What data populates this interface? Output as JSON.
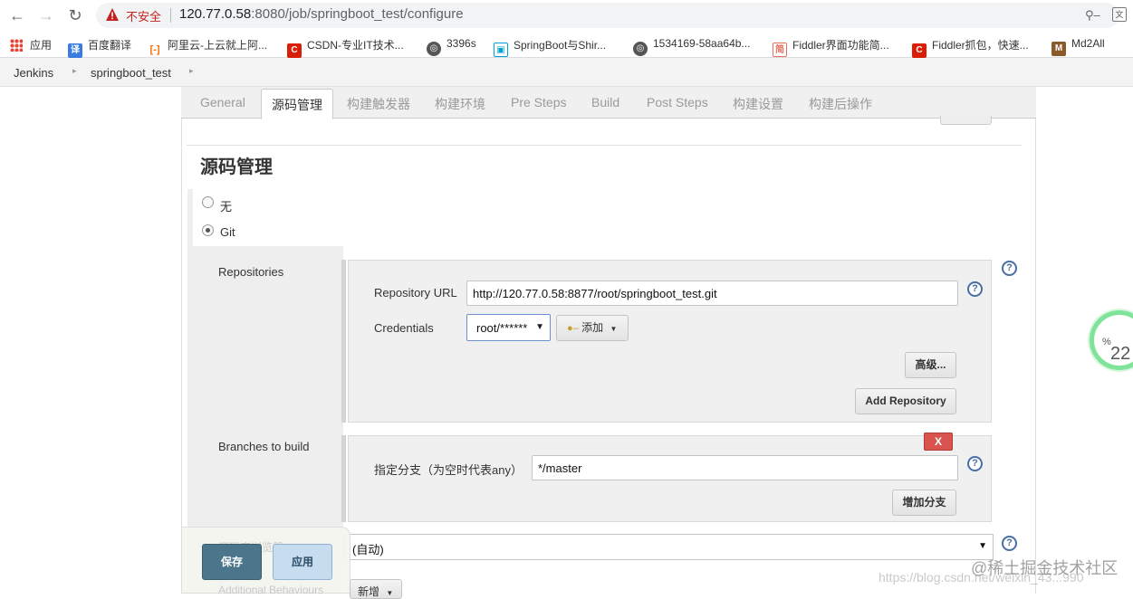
{
  "browser": {
    "insecure_label": "不安全",
    "url_host": "120.77.0.58",
    "url_rest": ":8080/job/springboot_test/configure"
  },
  "bookmarks": [
    {
      "label": "应用",
      "icon": "apps-grid-icon"
    },
    {
      "label": "百度翻译",
      "icon": "baidu-translate-icon",
      "color": "#3a7be0",
      "glyph": "译"
    },
    {
      "label": "阿里云-上云就上阿...",
      "icon": "aliyun-icon",
      "color": "#ff6a00",
      "glyph": "[-]"
    },
    {
      "label": "CSDN-专业IT技术...",
      "icon": "csdn-icon",
      "color": "#d81e06",
      "glyph": "C"
    },
    {
      "label": "3396s",
      "icon": "globe-icon",
      "color": "#555",
      "glyph": "◎"
    },
    {
      "label": "SpringBoot与Shir...",
      "icon": "bilibili-icon",
      "color": "#00a1d6",
      "glyph": "▣"
    },
    {
      "label": "1534169-58aa64b...",
      "icon": "globe-icon",
      "color": "#555",
      "glyph": "◎"
    },
    {
      "label": "Fiddler界面功能简...",
      "icon": "jianshu-icon",
      "color": "#ea6f5a",
      "glyph": "简"
    },
    {
      "label": "Fiddler抓包，快速...",
      "icon": "csdn-icon",
      "color": "#d81e06",
      "glyph": "C"
    },
    {
      "label": "Md2All",
      "icon": "md2all-icon",
      "color": "#8b5a2b",
      "glyph": "M"
    }
  ],
  "breadcrumb": [
    "Jenkins",
    "springboot_test"
  ],
  "tabs": [
    {
      "label": "General",
      "active": false
    },
    {
      "label": "源码管理",
      "active": true
    },
    {
      "label": "构建触发器",
      "active": false
    },
    {
      "label": "构建环境",
      "active": false
    },
    {
      "label": "Pre Steps",
      "active": false
    },
    {
      "label": "Build",
      "active": false
    },
    {
      "label": "Post Steps",
      "active": false
    },
    {
      "label": "构建设置",
      "active": false
    },
    {
      "label": "构建后操作",
      "active": false
    }
  ],
  "scm": {
    "title": "源码管理",
    "option_none": "无",
    "option_git": "Git",
    "selected": "Git",
    "repositories_label": "Repositories",
    "repo_url_label": "Repository URL",
    "repo_url_value": "http://120.77.0.58:8877/root/springboot_test.git",
    "credentials_label": "Credentials",
    "credentials_value": "root/******",
    "add_button": "添加",
    "advanced_button": "高级...",
    "add_repository_button": "Add Repository",
    "branches_label": "Branches to build",
    "branch_spec_label": "指定分支（为空时代表any）",
    "branch_spec_value": "*/master",
    "delete_button": "X",
    "add_branch_button": "增加分支",
    "browser_label": "源码库浏览器",
    "browser_value": "(自动)",
    "behaviours_label": "Additional Behaviours",
    "new_button": "新增"
  },
  "footer": {
    "save": "保存",
    "apply": "应用"
  },
  "overlay": {
    "progress_percent": 22,
    "progress_unit": "%",
    "watermark": "@稀土掘金技术社区",
    "watermark_url": "https://blog.csdn.net/weixin_43...990"
  },
  "colors": {
    "save_bg": "#4b758b",
    "apply_bg": "#c7dcef",
    "delete_bg": "#d9534f",
    "help_blue": "#4a6fa5",
    "insecure_red": "#c5221f"
  }
}
